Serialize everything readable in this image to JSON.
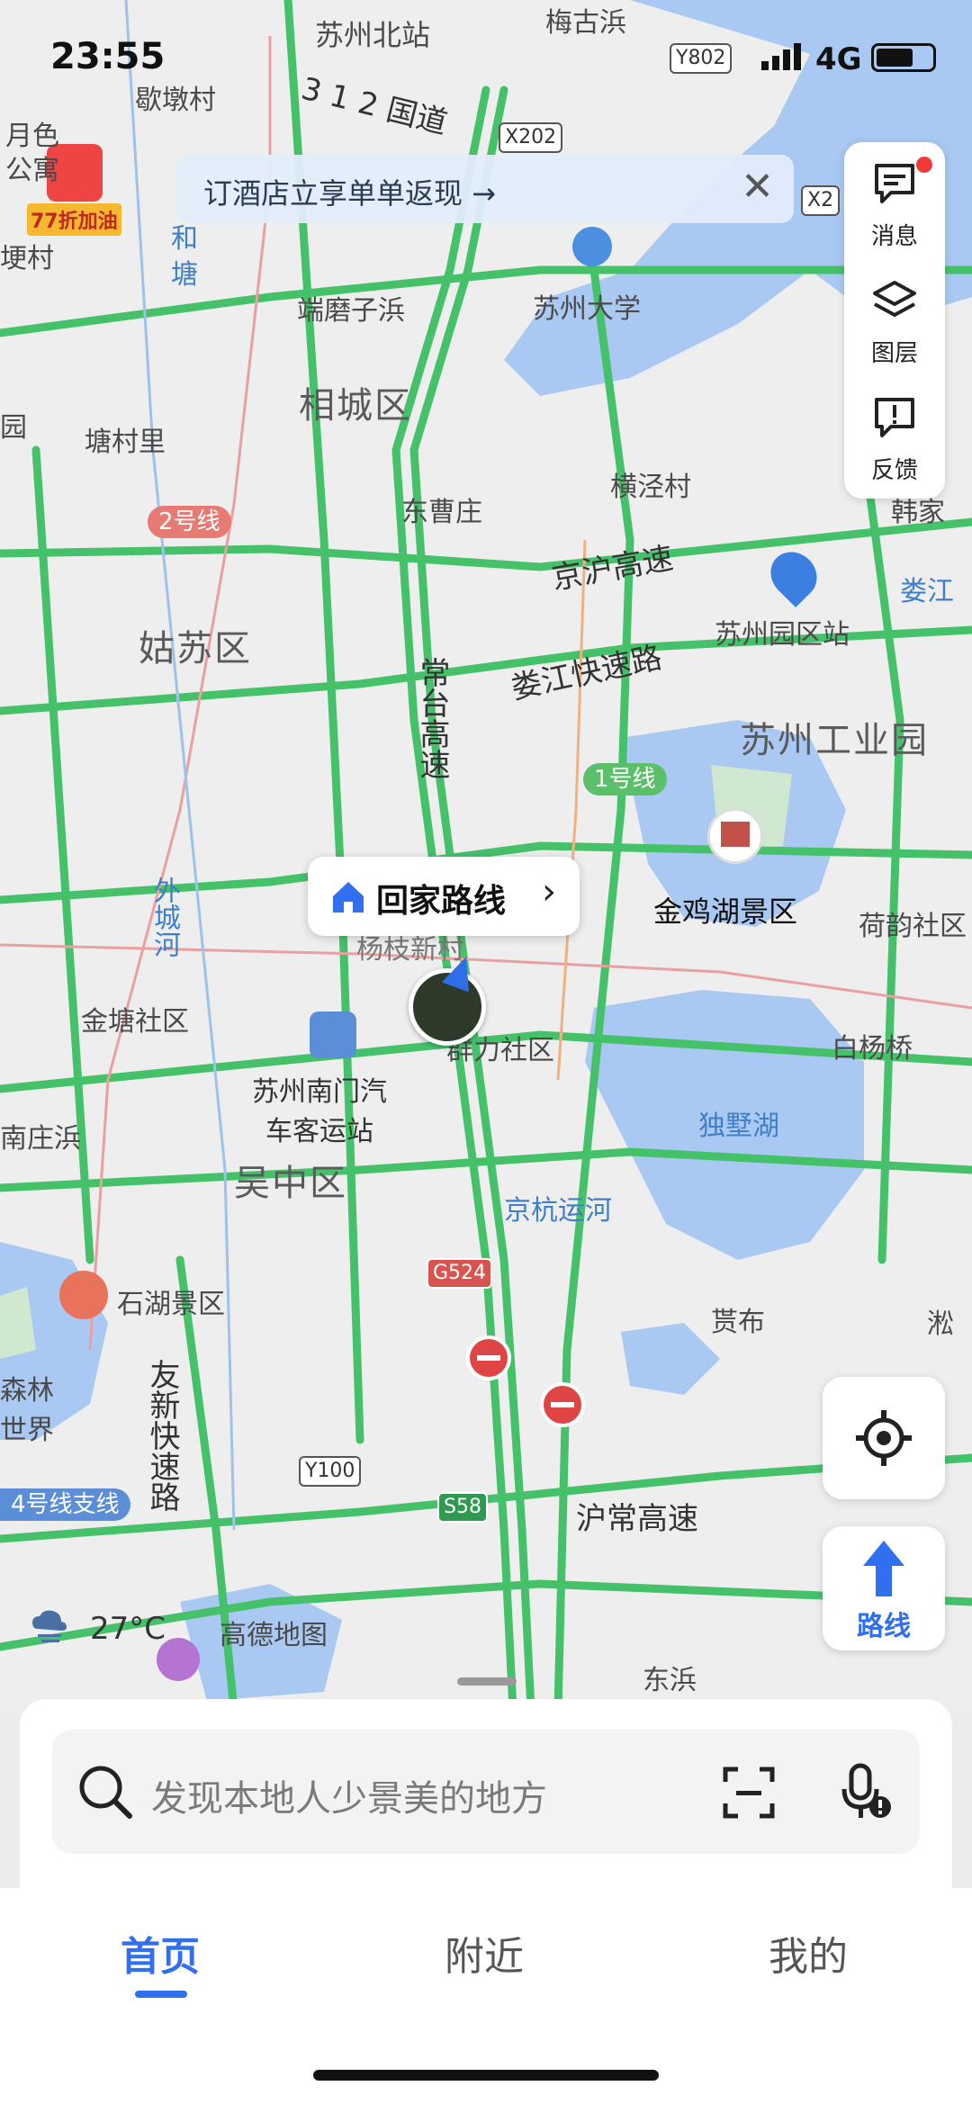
{
  "status_bar": {
    "time": "23:55",
    "network": "4G"
  },
  "promo": {
    "text": "订酒店立享单单返现 →",
    "close": "✕"
  },
  "fuel_badge": {
    "text": "77折加油"
  },
  "side_panel": {
    "messages": "消息",
    "layers": "图层",
    "feedback": "反馈"
  },
  "home_route": {
    "label": "回家路线",
    "chevron": "›"
  },
  "map_labels": {
    "suzhou_north": "苏州北站",
    "meigu": "梅古浜",
    "xiedun": "歇墩村",
    "yuese": "月色",
    "gongyu": "公寓",
    "bingcun": "埂村",
    "he": "和",
    "tang": "塘",
    "duanmo": "端磨子浜",
    "suda": "苏州大学",
    "xiangcheng": "相城区",
    "yuan": "园",
    "tangcunli": "塘村里",
    "dongcaozhuang": "东曹庄",
    "hengjingcun": "横泾村",
    "hanjia": "韩家",
    "jinghu": "京沪高速",
    "loujiang": "娄江",
    "gusu": "姑苏区",
    "changtai": "常台高速",
    "loujiang_exp": "娄江快速路",
    "suzhou_park_station": "苏州园区站",
    "sip": "苏州工业园",
    "waicheng": "外城河",
    "jinjihu": "金鸡湖景区",
    "heyun": "荷韵社区",
    "yangzhi": "杨枝新村",
    "jintang": "金塘社区",
    "nanmen": "苏州南门汽车客运站",
    "qunli": "群力社区",
    "baiyangqiao": "白杨桥",
    "dushu": "独墅湖",
    "nanzhuang": "南庄浜",
    "wuzhong": "吴中区",
    "jinghang": "京杭运河",
    "shihu": "石湖景区",
    "senlin": "森林世界",
    "youxin": "友新快速路",
    "guanbu": "贳布",
    "song": "淞",
    "huchang": "沪常高速",
    "gaode": "高德地图",
    "dongbang": "东浜",
    "weather": "27°C"
  },
  "shields": {
    "y802": "Y802",
    "x202": "X202",
    "x2": "X2",
    "g312": "3 1 2 国道",
    "g524": "G524",
    "y100": "Y100",
    "s58": "S58"
  },
  "metro": {
    "line2": "2号线",
    "line1": "1号线",
    "line4": "4号线支线"
  },
  "buttons": {
    "route": "路线"
  },
  "search": {
    "placeholder": "发现本地人少景美的地方"
  },
  "tabs": [
    {
      "label": "首页"
    },
    {
      "label": "附近"
    },
    {
      "label": "我的"
    }
  ]
}
